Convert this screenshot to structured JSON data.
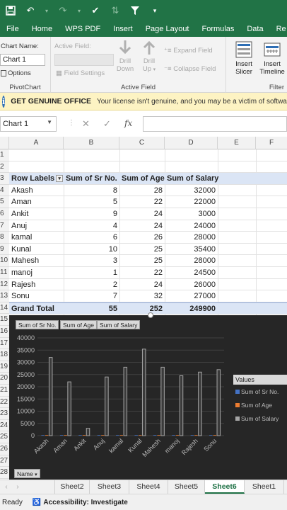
{
  "ribbon_tabs": [
    "File",
    "Home",
    "WPS PDF",
    "Insert",
    "Page Layout",
    "Formulas",
    "Data",
    "Re"
  ],
  "ribbon": {
    "chart_name_label": "Chart Name:",
    "chart_name_value": "Chart 1",
    "options_label": "Options",
    "pivotchart_group": "PivotChart",
    "active_field_label": "Active Field:",
    "field_settings": "Field Settings",
    "drill_down": "Drill Down",
    "drill_up": "Drill Up",
    "expand_field": "Expand Field",
    "collapse_field": "Collapse Field",
    "active_field_group": "Active Field",
    "insert_slicer": "Insert Slicer",
    "insert_timeline": "Insert Timeline",
    "filter_group": "Filter"
  },
  "genuine_bar": {
    "title": "GET GENUINE OFFICE",
    "message": "Your license isn't genuine, and you may be a victim of software"
  },
  "formula_bar": {
    "name_box": "Chart 1",
    "fx": "fx"
  },
  "columns": [
    "A",
    "B",
    "C",
    "D",
    "E",
    "F"
  ],
  "row_numbers": [
    "1",
    "2",
    "3",
    "4",
    "5",
    "6",
    "7",
    "8",
    "9",
    "10",
    "11",
    "12",
    "13",
    "14",
    "15",
    "16",
    "17",
    "18",
    "19",
    "20",
    "21",
    "22",
    "23",
    "24",
    "25",
    "26",
    "27",
    "28"
  ],
  "pivot": {
    "headers": [
      "Row Labels",
      "Sum of Sr No.",
      "Sum of Age",
      "Sum of Salary"
    ],
    "rows": [
      [
        "Akash",
        "8",
        "28",
        "32000"
      ],
      [
        "Aman",
        "5",
        "22",
        "22000"
      ],
      [
        "Ankit",
        "9",
        "24",
        "3000"
      ],
      [
        "Anuj",
        "4",
        "24",
        "24000"
      ],
      [
        "kamal",
        "6",
        "26",
        "28000"
      ],
      [
        "Kunal",
        "10",
        "25",
        "35400"
      ],
      [
        "Mahesh",
        "3",
        "25",
        "28000"
      ],
      [
        "manoj",
        "1",
        "22",
        "24500"
      ],
      [
        "Rajesh",
        "2",
        "24",
        "26000"
      ],
      [
        "Sonu",
        "7",
        "32",
        "27000"
      ]
    ],
    "total": [
      "Grand Total",
      "55",
      "252",
      "249900"
    ]
  },
  "chart_field_buttons": [
    "Sum of Sr No.",
    "Sum of Age",
    "Sum of Salary"
  ],
  "chart_name_button": "Name",
  "chart_data": {
    "type": "bar",
    "categories": [
      "Akash",
      "Aman",
      "Ankit",
      "Anuj",
      "kamal",
      "Kunal",
      "Mahesh",
      "manoj",
      "Rajesh",
      "Sonu"
    ],
    "series": [
      {
        "name": "Sum of Sr No.",
        "values": [
          8,
          5,
          9,
          4,
          6,
          10,
          3,
          1,
          2,
          7
        ],
        "color": "#4472c4"
      },
      {
        "name": "Sum of Age",
        "values": [
          28,
          22,
          24,
          24,
          26,
          25,
          25,
          22,
          24,
          32
        ],
        "color": "#ed7d31"
      },
      {
        "name": "Sum of Salary",
        "values": [
          32000,
          22000,
          3000,
          24000,
          28000,
          35400,
          28000,
          24500,
          26000,
          27000
        ],
        "color": "#a5a5a5"
      }
    ],
    "ylim": [
      0,
      40000
    ],
    "yticks": [
      "0",
      "5000",
      "10000",
      "15000",
      "20000",
      "25000",
      "30000",
      "35000",
      "40000"
    ],
    "legend_title": "Values",
    "legend_position": "right",
    "grid": true
  },
  "sheet_tabs": [
    "Sheet2",
    "Sheet3",
    "Sheet4",
    "Sheet5",
    "Sheet6",
    "Sheet1"
  ],
  "active_sheet": "Sheet6",
  "status": {
    "ready": "Ready",
    "accessibility": "Accessibility: Investigate"
  }
}
